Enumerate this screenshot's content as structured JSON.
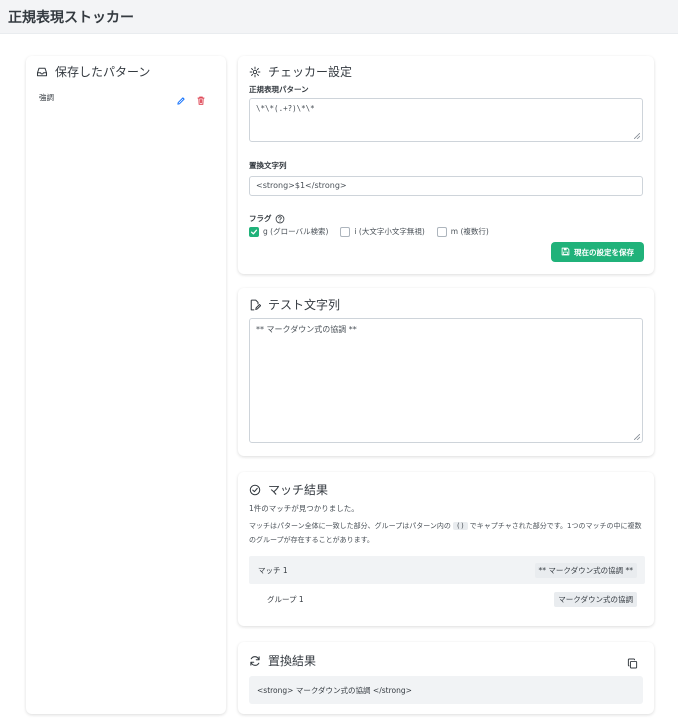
{
  "app": {
    "title": "正規表現ストッカー"
  },
  "saved": {
    "title": "保存したパターン",
    "items": [
      {
        "name": "強調"
      }
    ]
  },
  "checker": {
    "title": "チェッカー設定",
    "pattern_label": "正規表現パターン",
    "pattern_value": "\\*\\*(.+?)\\*\\*",
    "replacement_label": "置換文字列",
    "replacement_value": "<strong>$1</strong>",
    "flags_label": "フラグ",
    "flags": [
      {
        "label": "g (グローバル検索)",
        "checked": true
      },
      {
        "label": "i (大文字小文字無視)",
        "checked": false
      },
      {
        "label": "m (複数行)",
        "checked": false
      }
    ],
    "save_label": "現在の設定を保存"
  },
  "test": {
    "title": "テスト文字列",
    "value": "** マークダウン式の協調 **"
  },
  "match": {
    "title": "マッチ結果",
    "summary": "1件のマッチが見つかりました。",
    "desc_before": "マッチはパターン全体に一致した部分、グループはパターン内の",
    "desc_code": "()",
    "desc_after": "でキャプチャされた部分です。1つのマッチの中に複数のグループが存在することがあります。",
    "rows": [
      {
        "label": "マッチ 1",
        "value": "** マークダウン式の協調 **"
      },
      {
        "label": "グループ 1",
        "value": "マークダウン式の協調"
      }
    ]
  },
  "replace": {
    "title": "置換結果",
    "value": "<strong> マークダウン式の協調 </strong>"
  },
  "colors": {
    "accent": "#20b27a",
    "danger": "#dc3545",
    "primary": "#0d6efd"
  }
}
